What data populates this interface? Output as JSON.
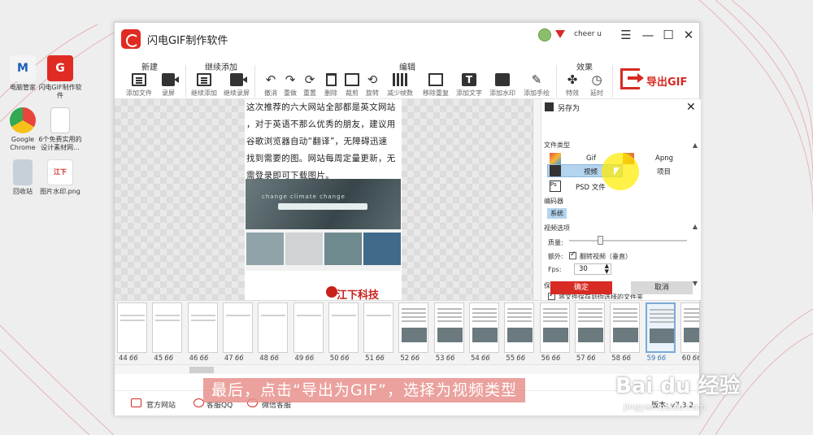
{
  "desktop": {
    "icons": [
      {
        "label": "电脑管家",
        "color": "#1b5fb5",
        "icon": "pc-manager-icon"
      },
      {
        "label": "闪电GIF制作软件",
        "color": "#e02b23",
        "icon": "gif-app-icon"
      },
      {
        "label": "Google Chrome",
        "color": "#e8453c",
        "icon": "chrome-icon"
      },
      {
        "label": "6个免费实用的设计素材网...",
        "color": "#f2f2f2",
        "icon": "document-icon"
      },
      {
        "label": "回收站",
        "color": "#9aa6b0",
        "icon": "recycle-bin-icon"
      },
      {
        "label": "图片水印.png",
        "color": "#ffffff",
        "icon": "image-file-icon"
      }
    ]
  },
  "window": {
    "title": "闪电GIF制作软件",
    "user": "cheer u",
    "controls": [
      "☰",
      "—",
      "☐",
      "✕"
    ]
  },
  "ribbon": {
    "groups": [
      "新建",
      "继续添加",
      "编辑",
      "效果"
    ],
    "tools": {
      "add_file": "添加文件",
      "record": "录屏",
      "continue_add": "继续添加",
      "continue_record": "继续录屏",
      "undo": "撤消",
      "redo": "重做",
      "reset": "重置",
      "delete": "删除",
      "crop": "裁剪",
      "rotate": "旋转",
      "reduce_frames": "减少帧数",
      "remove_dup": "移除重复",
      "add_text": "添加文字",
      "add_watermark": "添加水印",
      "add_handwriting": "添加手绘",
      "effects": "特效",
      "delay": "延时"
    },
    "export_label": "导出GIF"
  },
  "canvas": {
    "article_lines": [
      "这次推荐的六大网站全部都是英文网站",
      "，对于英语不那么优秀的朋友，建议用",
      "谷歌浏览器自动“翻译”，无障碍迅速",
      "找到需要的图。网站每周定量更新，无",
      "需登录即可下载图片。"
    ],
    "hero_text": "change climate change",
    "watermark": "江下科技"
  },
  "save_panel": {
    "title": "另存为",
    "file_type_label": "文件类型",
    "types": {
      "gif": "Gif",
      "apng": "Apng",
      "video": "视频",
      "project": "项目",
      "psd": "PSD 文件"
    },
    "encoder_label": "编码器",
    "encoder_value": "系统",
    "video_options_label": "视频选项",
    "quality_label": "质量:",
    "quality_level": 0.25,
    "extra_label": "额外:",
    "flip_label": "翻转视频（垂直）",
    "fps_label": "Fps:",
    "fps_value": "30",
    "save_options_label": "保存选项",
    "save_option_text": "将文件保存到你选择的文件夹",
    "ok": "确定",
    "cancel": "取消"
  },
  "filmstrip": {
    "duration": "66 ms",
    "frames": [
      {
        "n": "44",
        "kind": "text"
      },
      {
        "n": "45",
        "kind": "text"
      },
      {
        "n": "46",
        "kind": "text"
      },
      {
        "n": "47",
        "kind": "text"
      },
      {
        "n": "48",
        "kind": "text"
      },
      {
        "n": "49",
        "kind": "text"
      },
      {
        "n": "50",
        "kind": "text"
      },
      {
        "n": "51",
        "kind": "text"
      },
      {
        "n": "52",
        "kind": "site"
      },
      {
        "n": "53",
        "kind": "site"
      },
      {
        "n": "54",
        "kind": "site"
      },
      {
        "n": "55",
        "kind": "site"
      },
      {
        "n": "56",
        "kind": "site"
      },
      {
        "n": "57",
        "kind": "site"
      },
      {
        "n": "58",
        "kind": "site"
      },
      {
        "n": "59",
        "kind": "site",
        "selected": true
      },
      {
        "n": "60",
        "kind": "site"
      }
    ]
  },
  "footer": {
    "links": [
      "官方网站",
      "客服QQ",
      "微信客服"
    ],
    "version": "版本: v7.3.2"
  },
  "overlay": {
    "caption": "最后，点击“导出为GIF”，选择为视频类型",
    "baidu_logo": "Bai du 经验",
    "baidu_url": "jingyan.baidu.com"
  }
}
